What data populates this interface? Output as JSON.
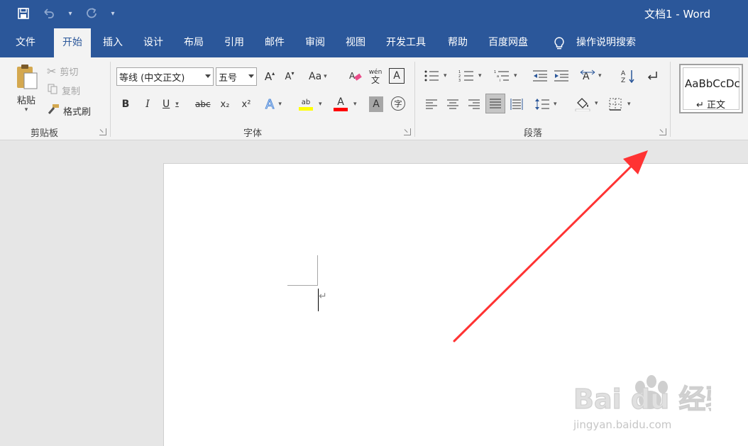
{
  "window": {
    "title": "文档1  -  Word"
  },
  "qat": {
    "save_icon": "save-icon",
    "undo_icon": "undo-icon",
    "redo_icon": "redo-icon",
    "customize_icon": "customize-qat-icon"
  },
  "tabs": [
    {
      "label": "文件"
    },
    {
      "label": "开始"
    },
    {
      "label": "插入"
    },
    {
      "label": "设计"
    },
    {
      "label": "布局"
    },
    {
      "label": "引用"
    },
    {
      "label": "邮件"
    },
    {
      "label": "审阅"
    },
    {
      "label": "视图"
    },
    {
      "label": "开发工具"
    },
    {
      "label": "帮助"
    },
    {
      "label": "百度网盘"
    }
  ],
  "tell_me": {
    "label": "操作说明搜索"
  },
  "clipboard": {
    "paste_label": "粘贴",
    "cut_label": "剪切",
    "copy_label": "复制",
    "format_painter_label": "格式刷",
    "group_label": "剪贴板"
  },
  "font": {
    "font_name": "等线 (中文正文)",
    "font_size": "五号",
    "bold": "B",
    "italic": "I",
    "underline": "U",
    "strikethrough": "abc",
    "subscript": "x₂",
    "superscript": "x²",
    "grow": "A",
    "shrink": "A",
    "change_case": "Aa",
    "phonetic_top": "wén",
    "phonetic_bottom": "文",
    "char_border": "A",
    "text_effects": "A",
    "font_color": "A",
    "char_shading": "A",
    "enclose_char": "字",
    "group_label": "字体",
    "highlight_color": "#ffff00",
    "font_color_value": "#ff0000"
  },
  "paragraph": {
    "group_label": "段落"
  },
  "styles": {
    "sample": "AaBbCcDc",
    "name": "↵ 正文"
  },
  "document": {
    "paragraph_mark": "↵"
  },
  "watermark": {
    "brand": "Bai du 经验",
    "url": "jingyan.baidu.com"
  },
  "colors": {
    "accent": "#2b579a",
    "annotation_arrow": "#ff3333"
  }
}
